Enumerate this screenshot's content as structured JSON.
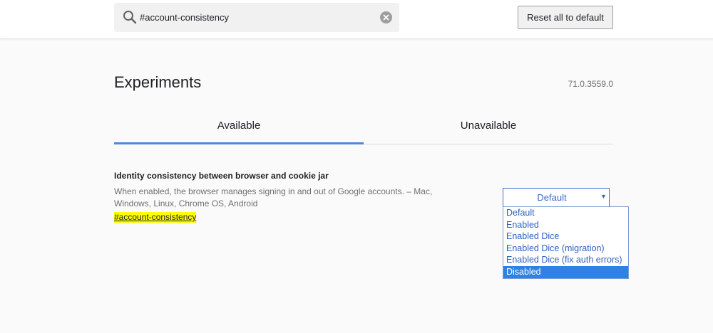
{
  "header": {
    "search": {
      "value": "#account-consistency",
      "icon": "search-icon",
      "clear_icon": "close-icon"
    },
    "reset_label": "Reset all to default"
  },
  "page": {
    "title": "Experiments",
    "version": "71.0.3559.0"
  },
  "tabs": [
    {
      "label": "Available",
      "active": true
    },
    {
      "label": "Unavailable",
      "active": false
    }
  ],
  "experiment": {
    "title": "Identity consistency between browser and cookie jar",
    "description": "When enabled, the browser manages signing in and out of Google accounts. – Mac, Windows, Linux, Chrome OS, Android",
    "link": "#account-consistency",
    "select": {
      "value": "Default",
      "options": [
        "Default",
        "Enabled",
        "Enabled Dice",
        "Enabled Dice (migration)",
        "Enabled Dice (fix auth errors)",
        "Disabled"
      ],
      "highlighted": "Disabled"
    }
  },
  "colors": {
    "accent": "#4f88d8",
    "highlight": "#ffff00",
    "option_selected": "#2e82e6"
  }
}
